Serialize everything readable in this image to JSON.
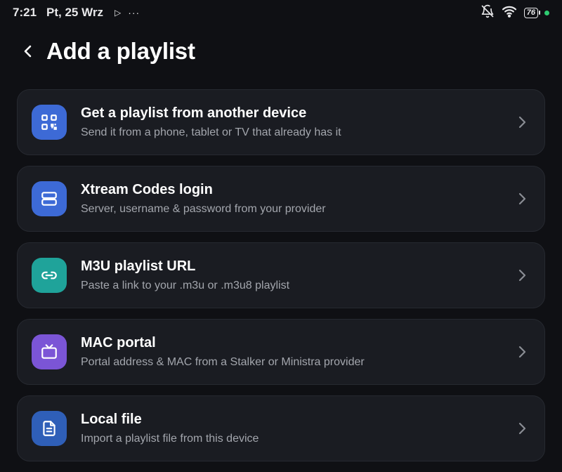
{
  "status_bar": {
    "time": "7:21",
    "date": "Pt, 25 Wrz",
    "battery": "76",
    "icons": [
      "play-icon",
      "more-dots-icon",
      "bell-off-icon",
      "wifi-icon",
      "battery-icon",
      "charging-dot"
    ]
  },
  "header": {
    "title": "Add a playlist",
    "back_icon": "chevron-left-icon"
  },
  "options": [
    {
      "title": "Get a playlist from another device",
      "subtitle": "Send it from a phone, tablet or TV that already has it",
      "icon": "qr-code-icon",
      "color": "#3d6ad6"
    },
    {
      "title": "Xtream Codes login",
      "subtitle": "Server, username & password from your provider",
      "icon": "server-icon",
      "color": "#3d6ad6"
    },
    {
      "title": "M3U playlist URL",
      "subtitle": "Paste a link to your .m3u or .m3u8 playlist",
      "icon": "link-icon",
      "color": "#1fa39a"
    },
    {
      "title": "MAC portal",
      "subtitle": "Portal address & MAC from a Stalker or Ministra provider",
      "icon": "tv-icon",
      "color": "#7b55d6"
    },
    {
      "title": "Local file",
      "subtitle": "Import a playlist file from this device",
      "icon": "file-icon",
      "color": "#2f5fb8"
    }
  ]
}
